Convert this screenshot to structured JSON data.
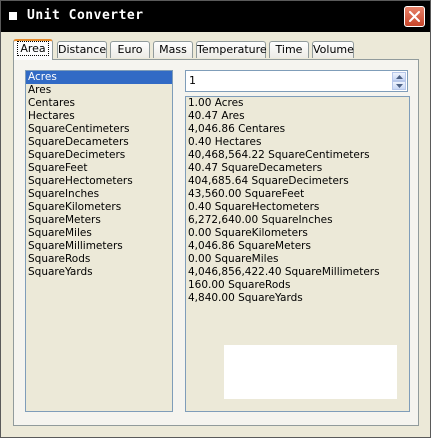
{
  "window": {
    "title": "Unit Converter"
  },
  "tabs": [
    {
      "label": "Area",
      "active": true
    },
    {
      "label": "Distance",
      "active": false
    },
    {
      "label": "Euro",
      "active": false
    },
    {
      "label": "Mass",
      "active": false
    },
    {
      "label": "Temperature",
      "active": false
    },
    {
      "label": "Time",
      "active": false
    },
    {
      "label": "Volume",
      "active": false
    }
  ],
  "units": {
    "selected": "Acres",
    "items": [
      "Acres",
      "Ares",
      "Centares",
      "Hectares",
      "SquareCentimeters",
      "SquareDecameters",
      "SquareDecimeters",
      "SquareFeet",
      "SquareHectometers",
      "SquareInches",
      "SquareKilometers",
      "SquareMeters",
      "SquareMiles",
      "SquareMillimeters",
      "SquareRods",
      "SquareYards"
    ]
  },
  "input": {
    "value": "1"
  },
  "results": [
    "1.00 Acres",
    "40.47 Ares",
    "4,046.86 Centares",
    "0.40 Hectares",
    "40,468,564.22 SquareCentimeters",
    "40.47 SquareDecameters",
    "404,685.64 SquareDecimeters",
    "43,560.00 SquareFeet",
    "0.40 SquareHectometers",
    "6,272,640.00 SquareInches",
    "0.00 SquareKilometers",
    "4,046.86 SquareMeters",
    "0.00 SquareMiles",
    "4,046,856,422.40 SquareMillimeters",
    "160.00 SquareRods",
    "4,840.00 SquareYards"
  ],
  "icons": {
    "app": "app-icon",
    "close": "close-icon",
    "spin_up": "spin-up-icon",
    "spin_down": "spin-down-icon"
  },
  "colors": {
    "titlebar": "#000000",
    "selection": "#316ac5",
    "active_tab_accent": "#e68b2c",
    "close_button": "#c8452a"
  }
}
